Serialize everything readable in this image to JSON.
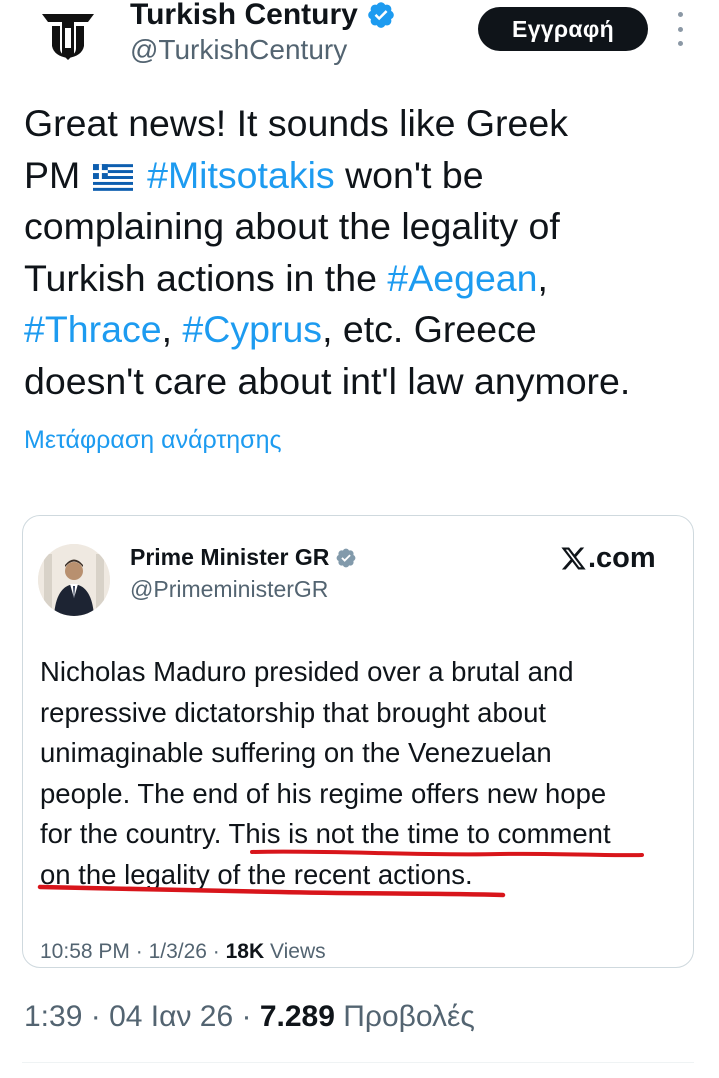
{
  "account": {
    "name": "Turkish Century",
    "handle": "@TurkishCentury",
    "follow_label": "Εγγραφή"
  },
  "tweet": {
    "lines": [
      [
        {
          "t": "Great news! It sounds like Greek"
        }
      ],
      [
        {
          "t": "PM "
        },
        {
          "flag": "greece-flag-emoji"
        },
        {
          "t": " "
        },
        {
          "h": "#Mitsotakis"
        },
        {
          "t": " won't be"
        }
      ],
      [
        {
          "t": "complaining about the legality of"
        }
      ],
      [
        {
          "t": "Turkish actions in the "
        },
        {
          "h": "#Aegean"
        },
        {
          "t": ","
        }
      ],
      [
        {
          "h": "#Thrace"
        },
        {
          "t": ", "
        },
        {
          "h": "#Cyprus"
        },
        {
          "t": ", etc. Greece"
        }
      ],
      [
        {
          "t": "doesn't care about int'l law anymore."
        }
      ]
    ],
    "translate_label": "Μετάφραση ανάρτησης",
    "time": "1:39",
    "date": "04 Ιαν 26",
    "views_count": "7.289",
    "views_label": "Προβολές"
  },
  "quote": {
    "name": "Prime Minister GR",
    "handle": "@PrimeministerGR",
    "source": ".com",
    "lines": [
      "Nicholas Maduro presided over a brutal and",
      "repressive dictatorship that brought about",
      "unimaginable suffering on the Venezuelan",
      "people. The end of his regime offers new hope",
      "for the country. This is not the time to comment",
      "on the legality of the recent actions."
    ],
    "time": "10:58 PM",
    "date": "1/3/26",
    "views_count": "18K",
    "views_label": "Views"
  },
  "icons": {
    "avatar": "turkish-century-logo",
    "verified": "verified-badge-icon",
    "more": "more-options-icon",
    "x_logo": "x-logo-icon",
    "flag": "greece-flag-emoji"
  },
  "colors": {
    "hashtag": "#1d9bf0",
    "text": "#0f1419",
    "muted": "#536471",
    "underline": "#d8151b",
    "verified": "#1d9bf0",
    "quote_verified": "#829aab"
  }
}
